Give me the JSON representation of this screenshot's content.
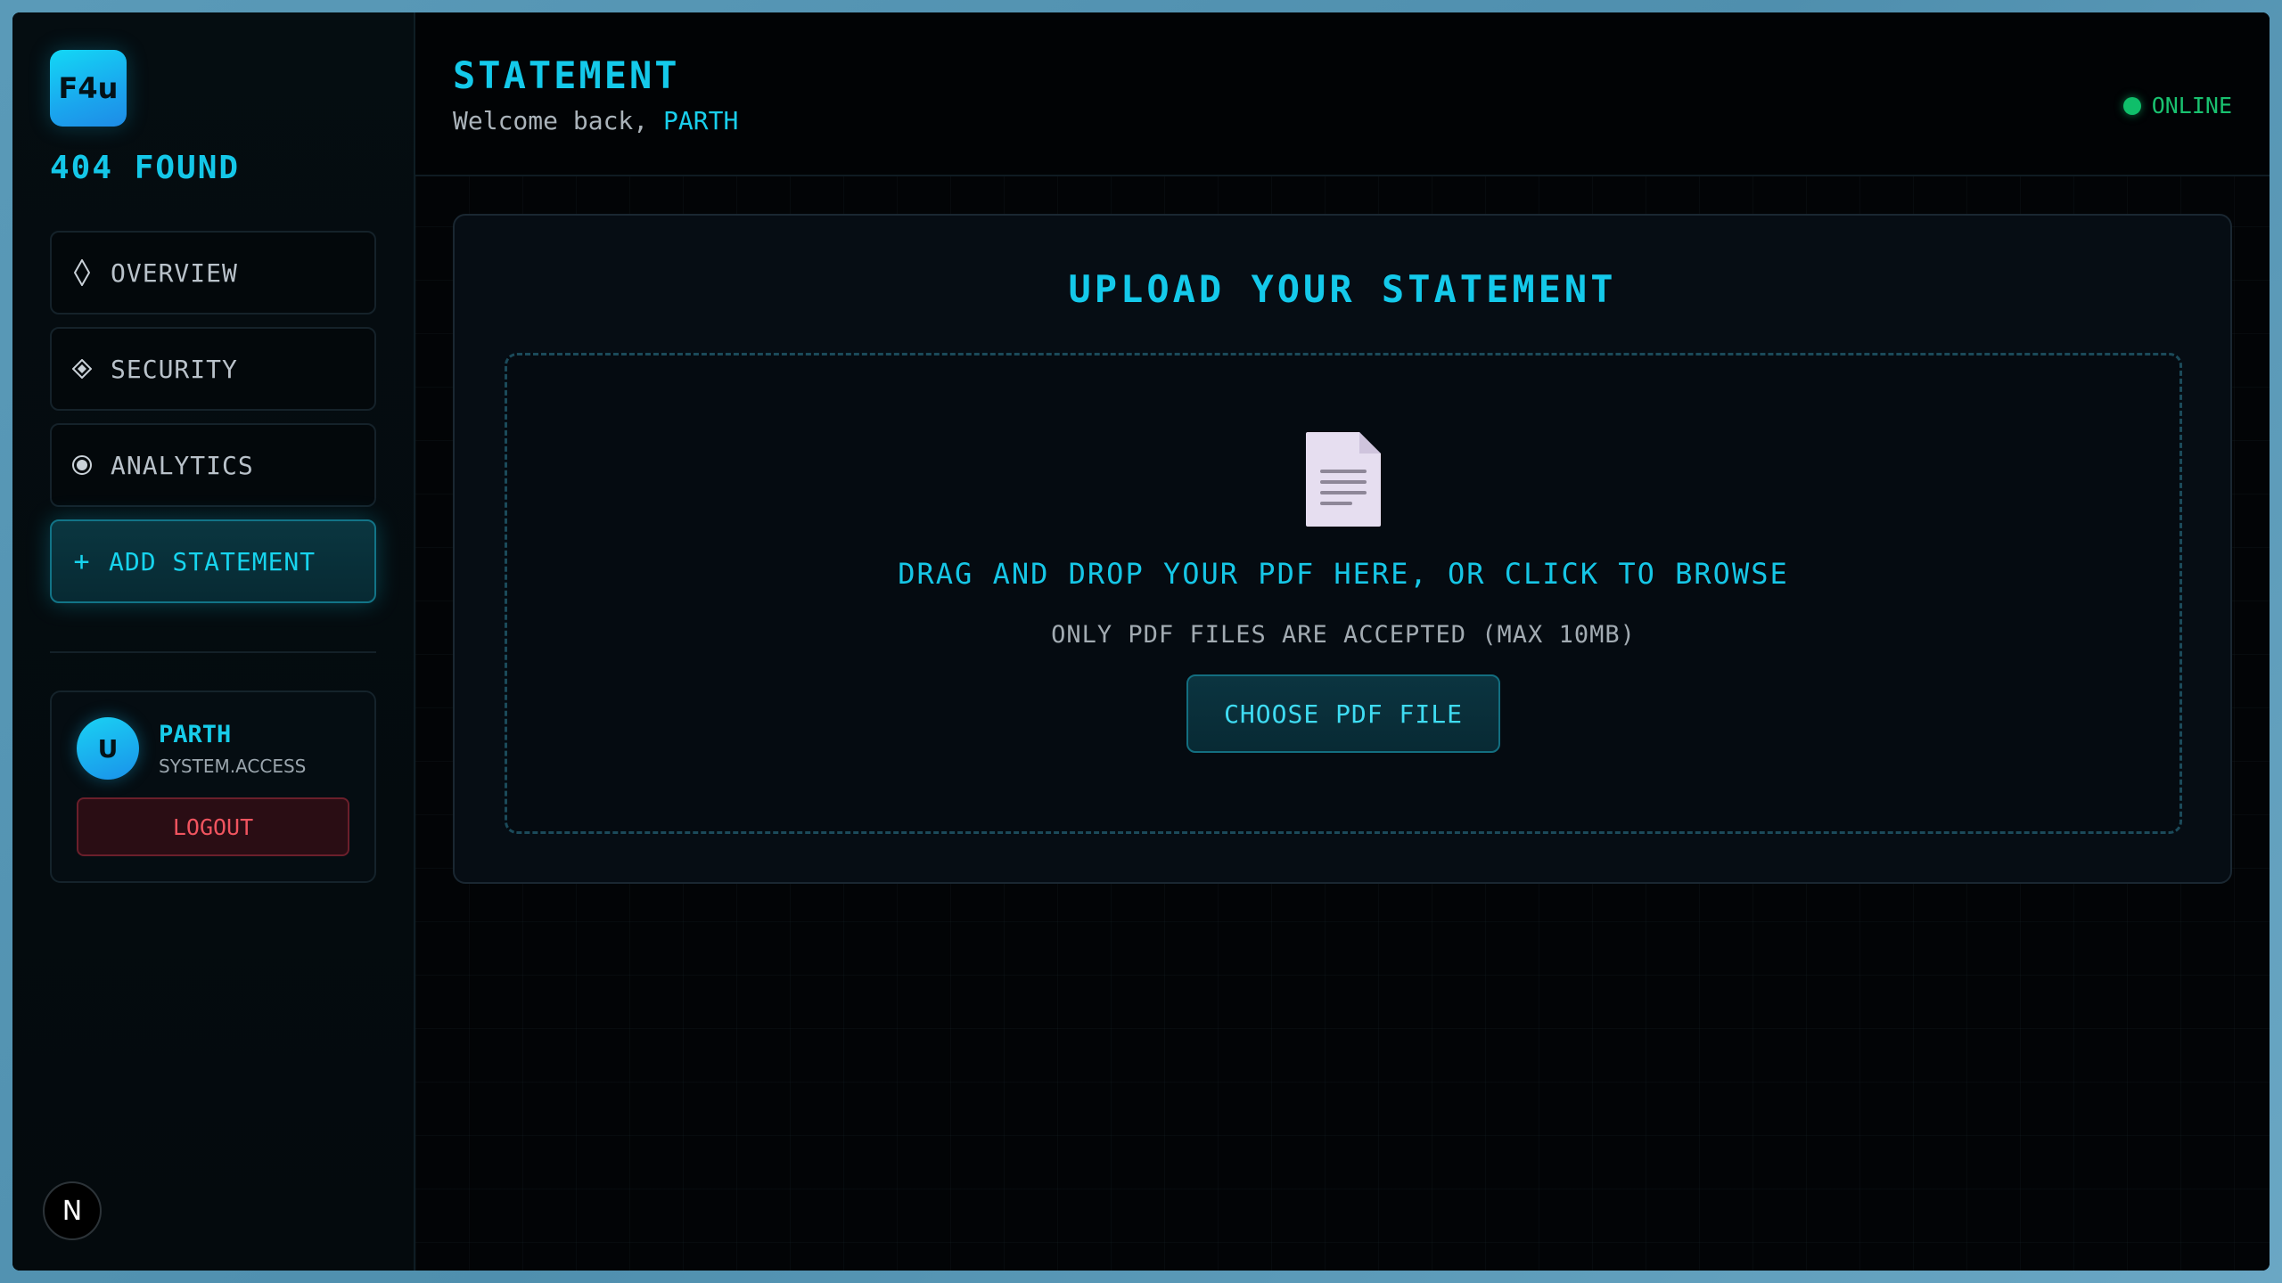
{
  "brand": {
    "logo_text": "F4u",
    "name": "404 FOUND"
  },
  "sidebar": {
    "items": [
      {
        "label": "OVERVIEW",
        "icon": "diamond-outline-icon"
      },
      {
        "label": "SECURITY",
        "icon": "diamond-dot-icon"
      },
      {
        "label": "ANALYTICS",
        "icon": "radio-dot-icon"
      },
      {
        "label": "ADD STATEMENT",
        "icon": "plus-icon",
        "prefix": "+"
      }
    ]
  },
  "user": {
    "avatar_initial": "U",
    "name": "PARTH",
    "role": "SYSTEM.ACCESS",
    "logout_label": "LOGOUT"
  },
  "framework_badge": "N",
  "header": {
    "title": "STATEMENT",
    "welcome_prefix": "Welcome back,",
    "welcome_name": "PARTH",
    "status": "ONLINE"
  },
  "upload": {
    "title": "UPLOAD YOUR STATEMENT",
    "drop_text": "DRAG AND DROP YOUR PDF HERE, OR CLICK TO BROWSE",
    "sub_text": "ONLY PDF FILES ARE ACCEPTED (MAX 10MB)",
    "button_label": "CHOOSE PDF FILE"
  },
  "colors": {
    "accent": "#14c9ea",
    "online": "#0fbe6a",
    "danger": "#f0545f"
  }
}
